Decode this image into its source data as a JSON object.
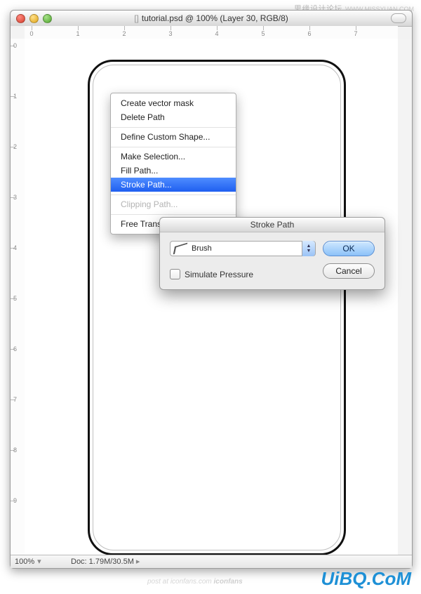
{
  "watermarks": {
    "top": "思缘设计论坛",
    "top_sub": "WWW.MISSYUAN.COM",
    "bottom": "UiBQ.CoM",
    "post_at_prefix": "post at ",
    "post_at_site": "iconfans.com",
    "post_at_brand": " iconfans"
  },
  "window": {
    "title": "tutorial.psd @ 100% (Layer 30, RGB/8)"
  },
  "ruler_top_labels": [
    "0",
    "1",
    "2",
    "3",
    "4",
    "5",
    "6",
    "7"
  ],
  "ruler_left_labels": [
    "0",
    "1",
    "2",
    "3",
    "4",
    "5",
    "6",
    "7",
    "8",
    "9"
  ],
  "statusbar": {
    "zoom": "100%",
    "doc": "Doc: 1.79M/30.5M"
  },
  "context_menu": {
    "items": [
      {
        "label": "Create vector mask",
        "disabled": false,
        "sep": false,
        "selected": false
      },
      {
        "label": "Delete Path",
        "disabled": false,
        "sep": false,
        "selected": false
      },
      {
        "label": "Define Custom Shape...",
        "disabled": false,
        "sep": true,
        "selected": false
      },
      {
        "label": "Make Selection...",
        "disabled": false,
        "sep": true,
        "selected": false
      },
      {
        "label": "Fill Path...",
        "disabled": false,
        "sep": false,
        "selected": false
      },
      {
        "label": "Stroke Path...",
        "disabled": false,
        "sep": false,
        "selected": true
      },
      {
        "label": "Clipping Path...",
        "disabled": true,
        "sep": true,
        "selected": false
      },
      {
        "label": "Free Transform Points",
        "disabled": false,
        "sep": true,
        "selected": false
      }
    ]
  },
  "dialog": {
    "title": "Stroke Path",
    "tool": "Brush",
    "simulate_pressure_label": "Simulate Pressure",
    "simulate_pressure_checked": false,
    "ok": "OK",
    "cancel": "Cancel"
  }
}
